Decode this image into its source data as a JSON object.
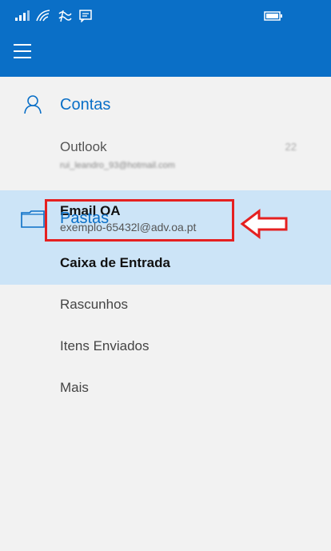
{
  "colors": {
    "accent": "#0a6fc7",
    "selection": "#cce4f7",
    "highlight": "#e52020"
  },
  "status_bar": {
    "icons": [
      "signal-icon",
      "wifi-icon",
      "data-icon",
      "message-icon",
      "battery-icon"
    ]
  },
  "app_bar": {
    "menu_icon": "hamburger-icon"
  },
  "accounts_section": {
    "label": "Contas",
    "icon": "person-icon",
    "items": [
      {
        "title": "Outlook",
        "subtitle": "rui_leandro_93@hotmail.com",
        "count": "22"
      },
      {
        "title": "Email OA",
        "subtitle": "exemplo-65432l@adv.oa.pt"
      }
    ]
  },
  "folders_section": {
    "label": "Pastas",
    "icon": "folder-icon",
    "items": [
      {
        "label": "Caixa de Entrada"
      },
      {
        "label": "Rascunhos"
      },
      {
        "label": "Itens Enviados"
      },
      {
        "label": "Mais"
      }
    ]
  },
  "annotation": {
    "arrow_icon": "left-arrow-icon"
  }
}
